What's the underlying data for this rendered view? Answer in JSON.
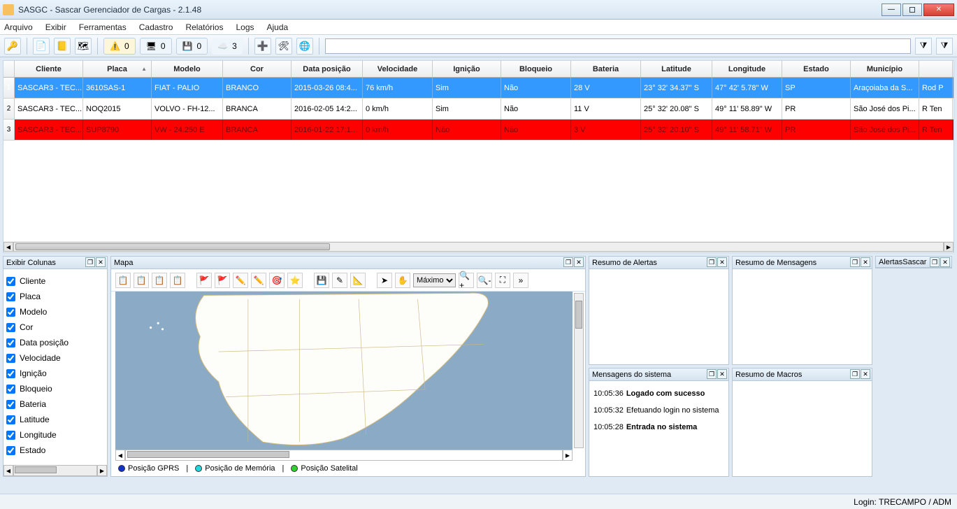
{
  "title": "SASGC - Sascar Gerenciador de Cargas - 2.1.48",
  "menu": [
    "Arquivo",
    "Exibir",
    "Ferramentas",
    "Cadastro",
    "Relatórios",
    "Logs",
    "Ajuda"
  ],
  "toolbar": {
    "badge1": "0",
    "badge2": "0",
    "badge3": "0",
    "badge4": "3"
  },
  "columns": [
    "Cliente",
    "Placa",
    "Modelo",
    "Cor",
    "Data posição",
    "Velocidade",
    "Ignição",
    "Bloqueio",
    "Bateria",
    "Latitude",
    "Longitude",
    "Estado",
    "Município",
    ""
  ],
  "rows": [
    {
      "n": "1",
      "sel": true,
      "cliente": "SASCAR3 - TEC...",
      "placa": "3610SAS-1",
      "modelo": "FIAT - PALIO",
      "cor": "BRANCO",
      "data": "2015-03-26 08:4...",
      "vel": "76 km/h",
      "ign": "Sim",
      "blo": "Não",
      "bat": "28 V",
      "lat": "23° 32' 34.37\" S",
      "lon": "47° 42' 5.78\" W",
      "est": "SP",
      "mun": "Araçoiaba da S...",
      "end": "Rod P"
    },
    {
      "n": "2",
      "cliente": "SASCAR3 - TEC...",
      "placa": "NOQ2015",
      "modelo": "VOLVO - FH-12...",
      "cor": "BRANCA",
      "data": "2016-02-05 14:2...",
      "vel": "0 km/h",
      "ign": "Sim",
      "blo": "Não",
      "bat": "11 V",
      "lat": "25° 32' 20.08\" S",
      "lon": "49° 11' 58.89\" W",
      "est": "PR",
      "mun": "São José dos Pi...",
      "end": "R Ten"
    },
    {
      "n": "3",
      "alert": true,
      "cliente": "SASCAR3 - TEC...",
      "placa": "SUP8790",
      "modelo": "VW - 24.250 E",
      "cor": "BRANCA",
      "data": "2016-01-22 17:1...",
      "vel": "0 km/h",
      "ign": "Não",
      "blo": "Não",
      "bat": "3 V",
      "lat": "25° 32' 20.10\" S",
      "lon": "49° 11' 58.71\" W",
      "est": "PR",
      "mun": "São José dos Pi...",
      "end": "R Ten"
    }
  ],
  "panels": {
    "exibirColunas": "Exibir Colunas",
    "mapa": "Mapa",
    "resumoAlertas": "Resumo de Alertas",
    "resumoMensagens": "Resumo de Mensagens",
    "alertasSascar": "AlertasSascar",
    "mensagensSistema": "Mensagens do sistema",
    "resumoMacros": "Resumo de Macros"
  },
  "columnChecks": [
    "Cliente",
    "Placa",
    "Modelo",
    "Cor",
    "Data posição",
    "Velocidade",
    "Ignição",
    "Bloqueio",
    "Bateria",
    "Latitude",
    "Longitude",
    "Estado"
  ],
  "mapZoom": "Máximo",
  "legend": {
    "gprs": "Posição GPRS",
    "mem": "Posição de Memória",
    "sat": "Posição Satelital"
  },
  "sysMsgs": [
    {
      "t": "10:05:36",
      "m": "Logado com sucesso",
      "b": true
    },
    {
      "t": "10:05:32",
      "m": "Efetuando login no sistema",
      "b": false
    },
    {
      "t": "10:05:28",
      "m": "Entrada no sistema",
      "b": true
    }
  ],
  "status": "Login: TRECAMPO / ADM"
}
